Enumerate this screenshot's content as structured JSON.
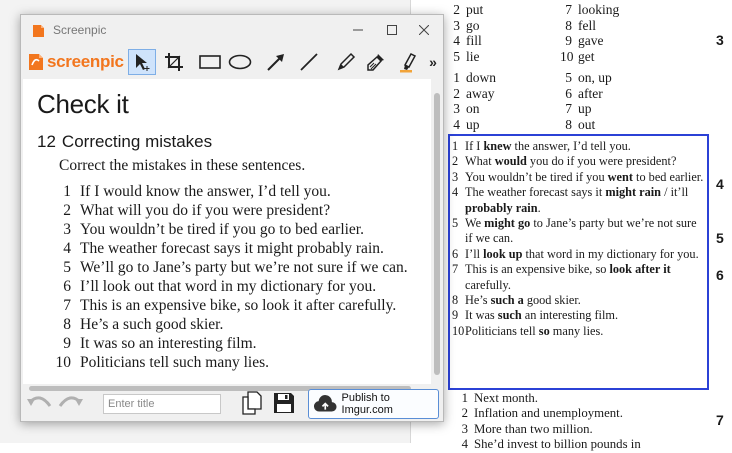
{
  "document": {
    "top_left_col": [
      {
        "n": "2",
        "w": "put"
      },
      {
        "n": "3",
        "w": "go"
      },
      {
        "n": "4",
        "w": "fill"
      },
      {
        "n": "5",
        "w": "lie"
      }
    ],
    "top_right_col": [
      {
        "n": "7",
        "w": "looking"
      },
      {
        "n": "8",
        "w": "fell"
      },
      {
        "n": "9",
        "w": "gave"
      },
      {
        "n": "10",
        "w": "get"
      }
    ],
    "second_left_col": [
      {
        "n": "1",
        "w": "down"
      },
      {
        "n": "2",
        "w": "away"
      },
      {
        "n": "3",
        "w": "on"
      },
      {
        "n": "4",
        "w": "up"
      }
    ],
    "second_right_col": [
      {
        "n": "5",
        "w": "on, up"
      },
      {
        "n": "6",
        "w": "after"
      },
      {
        "n": "7",
        "w": "up"
      },
      {
        "n": "8",
        "w": "out"
      }
    ],
    "side_markers": [
      "3",
      "4",
      "5",
      "6",
      "7"
    ],
    "answers": [
      {
        "n": "1",
        "html": "If I <b>knew</b> the answer, I’d tell you."
      },
      {
        "n": "2",
        "html": "What <b>would</b> you do if you were president?"
      },
      {
        "n": "3",
        "html": "You wouldn’t be tired if you <b>went</b> to bed earlier."
      },
      {
        "n": "4",
        "html": "The weather forecast says it <b>might rain</b> / it’ll <b>probably rain</b>."
      },
      {
        "n": "5",
        "html": "We <b>might go</b> to Jane’s party but we’re not sure if we can."
      },
      {
        "n": "6",
        "html": "I’ll <b>look up</b> that word in my dictionary for you."
      },
      {
        "n": "7",
        "html": "This is an expensive bike, so <b>look after it</b> carefully."
      },
      {
        "n": "8",
        "html": "He’s <b>such a</b> good skier."
      },
      {
        "n": "9",
        "html": "It was <b>such</b> an interesting film."
      },
      {
        "n": "10",
        "html": "Politicians tell <b>so</b> many lies."
      }
    ],
    "below_list": [
      {
        "n": "1",
        "t": "Next month."
      },
      {
        "n": "2",
        "t": "Inflation and unemployment."
      },
      {
        "n": "3",
        "t": "More than two million."
      },
      {
        "n": "4",
        "t": "She’d invest to billion pounds in"
      }
    ]
  },
  "window": {
    "title": "Screenpic",
    "logo_text": "screenpic",
    "tools": [
      "select-tool",
      "crop-tool",
      "rectangle-tool",
      "ellipse-tool",
      "arrow-tool",
      "line-tool",
      "pen-tool",
      "brush-tool",
      "marker-tool",
      "more-tools"
    ],
    "more_label": "»",
    "canvas": {
      "heading": "Check it",
      "exercise_number": "12",
      "exercise_title": "Correcting mistakes",
      "instruction": "Correct the mistakes in these sentences.",
      "sentences": [
        {
          "n": "1",
          "t": "If I would know the answer, I’d tell you."
        },
        {
          "n": "2",
          "t": "What will you do if you were president?"
        },
        {
          "n": "3",
          "t": "You wouldn’t be tired if you go to bed earlier."
        },
        {
          "n": "4",
          "t": "The weather forecast says it might probably rain."
        },
        {
          "n": "5",
          "t": "We’ll go to Jane’s party but we’re not sure if we can."
        },
        {
          "n": "6",
          "t": "I’ll look out that word in my dictionary for you."
        },
        {
          "n": "7",
          "t": "This is an expensive bike, so look it after carefully."
        },
        {
          "n": "8",
          "t": "He’s a such good skier."
        },
        {
          "n": "9",
          "t": "It was so an interesting film."
        },
        {
          "n": "10",
          "t": "Politicians tell such many lies."
        }
      ]
    },
    "bottom": {
      "title_placeholder": "Enter title",
      "publish_label": "Publish to Imgur.com"
    }
  },
  "colors": {
    "answer_box_border": "#2b41d6",
    "logo_orange": "#f2761e",
    "publish_border": "#5a8ed6"
  }
}
